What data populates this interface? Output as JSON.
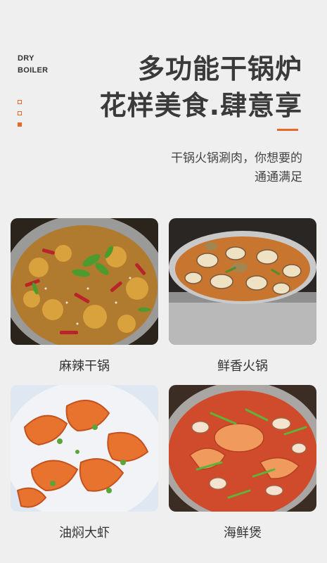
{
  "brand": {
    "line1": "DRY",
    "line2": "BOILER"
  },
  "headline": {
    "line1": "多功能干锅炉",
    "line2": "花样美食.肆意享"
  },
  "subtitle": {
    "line1": "干锅火锅涮肉，你想要的",
    "line2": "通通满足"
  },
  "dishes": [
    {
      "caption": "麻辣干锅",
      "image": "spicy-dry-pot-photo"
    },
    {
      "caption": "鲜香火锅",
      "image": "clam-hotpot-photo"
    },
    {
      "caption": "油焖大虾",
      "image": "braised-prawns-photo"
    },
    {
      "caption": "海鲜煲",
      "image": "seafood-pot-photo"
    }
  ],
  "colors": {
    "accent": "#e8672b",
    "background": "#efefef",
    "text": "#3a3a3a"
  }
}
